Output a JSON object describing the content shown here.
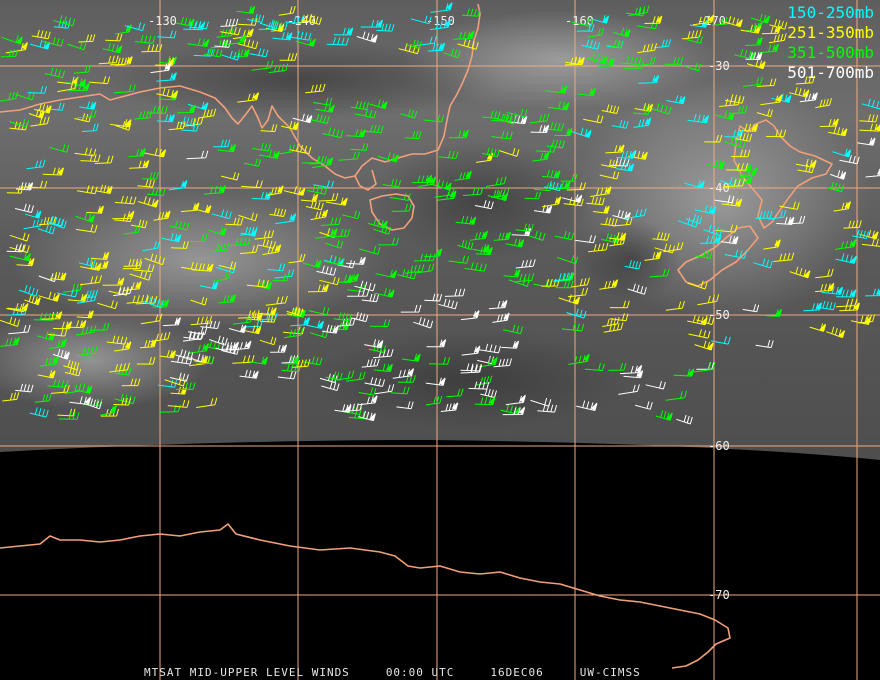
{
  "map": {
    "longitude_labels": [
      "-130",
      "-140",
      "-150",
      "-160",
      "-170"
    ],
    "latitude_labels": [
      "-30",
      "-40",
      "-50",
      "-60",
      "-70"
    ],
    "grid_color": "#f0a882",
    "coastline_color": "#f2a07a",
    "background_color": "#000000",
    "imagery_base_color": "#6a6a6a"
  },
  "legend": {
    "layers": [
      {
        "label": "150-250mb",
        "color": "#00ffff"
      },
      {
        "label": "251-350mb",
        "color": "#ffff00"
      },
      {
        "label": "351-500mb",
        "color": "#00ff00"
      },
      {
        "label": "501-700mb",
        "color": "#ffffff"
      }
    ]
  },
  "footer": {
    "product": "MTSAT MID-UPPER LEVEL WINDS",
    "time": "00:00 UTC",
    "date": "16DEC06",
    "source": "UW-CIMSS"
  }
}
